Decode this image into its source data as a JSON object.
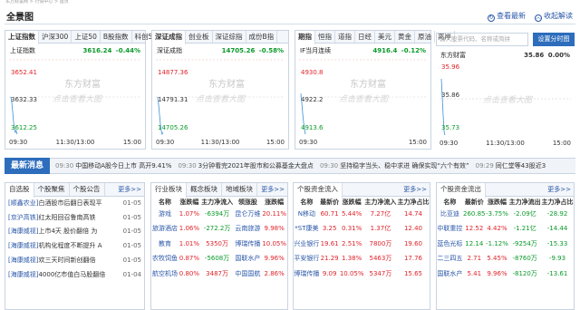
{
  "breadcrumb": "东方财富网 > 行情中心 > 首页",
  "page_title": "全景图",
  "header_links": {
    "view_latest": "查看最新",
    "collapse": "收起解读"
  },
  "watermark": "东方财富",
  "click_hint": "点击查看大图",
  "panels": [
    {
      "tabs": [
        "上证指数",
        "沪深300",
        "上证50",
        "B股指数",
        "科创50"
      ],
      "name": "上证指数",
      "price": "3616.24",
      "change": "-0.44%",
      "levels": [
        "3652.41",
        "3632.33",
        "3612.25"
      ],
      "xaxis": [
        "09:30",
        "11:30/13:00",
        "15:00"
      ]
    },
    {
      "tabs": [
        "深证成指",
        "创业板",
        "深证综指",
        "成份B指"
      ],
      "name": "深证成指",
      "price": "14705.26",
      "change": "-0.58%",
      "levels": [
        "14877.36",
        "14791.31",
        "14705.26"
      ],
      "xaxis": [
        "09:30",
        "11:30/13:00",
        "15:00"
      ]
    },
    {
      "tabs": [
        "期指",
        "恒指",
        "道指",
        "日经",
        "美元",
        "黄金",
        "原油",
        "离岸"
      ],
      "name": "IF当月连续",
      "price": "4916.4",
      "change": "-0.12%",
      "levels": [
        "4930.8",
        "4922.2",
        "4913.6"
      ],
      "xaxis": [
        "09:30",
        "15:00"
      ]
    },
    {
      "name": "东方财富",
      "price": "35.86",
      "change": "0.00%",
      "levels": [
        "35.96",
        "35.86",
        "35.73"
      ],
      "xaxis": [
        "09:30",
        "11:30/13:00",
        "15:00"
      ]
    }
  ],
  "search": {
    "placeholder": "输入股票代码、名称或简拼",
    "button": "设置分时图"
  },
  "news_ticker": {
    "title": "最新消息",
    "items": [
      {
        "time": "09:30",
        "text": "中国移动A股今日上市 高开9.41%"
      },
      {
        "time": "09:30",
        "text": "3分钟看完2021年股市和公募基金大盘点"
      },
      {
        "time": "09:30",
        "text": "坚持稳字当头、稳中求进 确保实现“六个有效”"
      },
      {
        "time": "09:29",
        "text": "同仁堂等43股近3"
      }
    ]
  },
  "stock_news": {
    "tabs": [
      "自选股",
      "个股聚焦",
      "个股公告"
    ],
    "more": "更多>>",
    "items": [
      {
        "src": "[顺鑫农业]",
        "text": "白酒股市后翻日表现平",
        "date": "01-05"
      },
      {
        "src": "[京沪高铁]",
        "text": "红太阳回召鲁南高铁",
        "date": "01-05"
      },
      {
        "src": "[海康威视]",
        "text": "上市4天 股价翻倍 为",
        "date": "01-05"
      },
      {
        "src": "[海康威视]",
        "text": "机构化程度不断提升 A",
        "date": "01-05"
      },
      {
        "src": "[海康威视]",
        "text": "欢三天时间新创翻倍",
        "date": "01-05"
      },
      {
        "src": "[海康威视]",
        "text": "4000亿市值白马股翻倍",
        "date": "01-04"
      }
    ]
  },
  "sector_table": {
    "tabs": [
      "行业板块",
      "概念板块",
      "地域板块"
    ],
    "more": "更多>>",
    "headers": [
      "名称",
      "涨跌幅",
      "主力净流入",
      "领涨股",
      "涨跌幅"
    ],
    "rows": [
      [
        "游戏",
        "1.07%",
        "-6394万",
        "昆仑万维",
        "20.11%"
      ],
      [
        "旅游酒店",
        "1.06%",
        "-272.2万",
        "云南旅游",
        "9.98%"
      ],
      [
        "教育",
        "1.01%",
        "5350万",
        "博瑞传播",
        "10.05%"
      ],
      [
        "农牧饲鱼",
        "0.87%",
        "-5608万",
        "国联水产",
        "9.96%"
      ],
      [
        "航空机场",
        "0.80%",
        "3487万",
        "中国国航",
        "2.86%"
      ]
    ]
  },
  "flow_in_table": {
    "tabs": [
      "个股资金流入"
    ],
    "more": "更多>>",
    "headers": [
      "名称",
      "最新价",
      "涨跌幅",
      "主力净流入",
      "主力净占比"
    ],
    "rows": [
      [
        "N移动",
        "60.71",
        "5.44%",
        "7.27亿",
        "14.74"
      ],
      [
        "*ST康美",
        "3.25",
        "0.31%",
        "1.37亿",
        "12.40"
      ],
      [
        "兴业银行",
        "19.61",
        "2.51%",
        "7800万",
        "19.60"
      ],
      [
        "平安银行",
        "21.29",
        "1.38%",
        "5463万",
        "17.76"
      ],
      [
        "博瑞传播",
        "9.09",
        "10.05%",
        "5347万",
        "15.65"
      ]
    ]
  },
  "flow_out_table": {
    "tabs": [
      "个股资金流出"
    ],
    "more": "更多>>",
    "headers": [
      "名称",
      "最新价",
      "涨跌幅",
      "主力净流出",
      "主力净占比"
    ],
    "rows": [
      [
        "比亚迪",
        "260.85",
        "-3.75%",
        "-2.09亿",
        "-28.92"
      ],
      [
        "中联重控",
        "12.52",
        "4.42%",
        "-1.21亿",
        "-14.44"
      ],
      [
        "蓝色光标",
        "12.14",
        "-1.12%",
        "-9254万",
        "-15.33"
      ],
      [
        "二三四五",
        "2.71",
        "5.45%",
        "-8760万",
        "-9.93"
      ],
      [
        "国联水产",
        "5.41",
        "9.96%",
        "-8120万",
        "-13.61"
      ]
    ]
  },
  "colors": {
    "accent": "#2d6dbc",
    "up": "#e0232a",
    "down": "#0a9a2a",
    "line": "#3a8fd8"
  }
}
